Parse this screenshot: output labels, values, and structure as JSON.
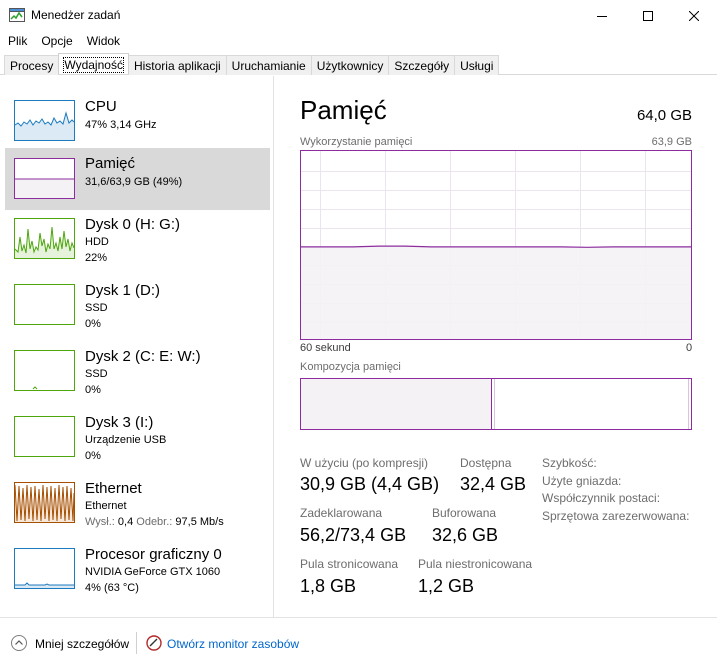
{
  "window": {
    "title": "Menedżer zadań"
  },
  "menu": [
    "Plik",
    "Opcje",
    "Widok"
  ],
  "tabs": [
    "Procesy",
    "Wydajność",
    "Historia aplikacji",
    "Uruchamianie",
    "Użytkownicy",
    "Szczegóły",
    "Usługi"
  ],
  "active_tab": "Wydajność",
  "sidebar": {
    "items": [
      {
        "title": "CPU",
        "line1": "47% 3,14 GHz",
        "line2": "",
        "color": "#1c7bbf",
        "selected": false
      },
      {
        "title": "Pamięć",
        "line1": "31,6/63,9 GB (49%)",
        "line2": "",
        "color": "#8c2c9e",
        "selected": true
      },
      {
        "title": "Dysk 0 (H: G:)",
        "line1": "HDD",
        "line2": "22%",
        "color": "#4da60c",
        "selected": false
      },
      {
        "title": "Dysk 1 (D:)",
        "line1": "SSD",
        "line2": "0%",
        "color": "#4da60c",
        "selected": false
      },
      {
        "title": "Dysk 2 (C: E: W:)",
        "line1": "SSD",
        "line2": "0%",
        "color": "#4da60c",
        "selected": false
      },
      {
        "title": "Dysk 3 (I:)",
        "line1": "Urządzenie USB",
        "line2": "0%",
        "color": "#4da60c",
        "selected": false
      },
      {
        "title": "Ethernet",
        "line1": "Ethernet",
        "line2_send_label": "Wysł.:",
        "line2_send_value": "0,4",
        "line2_recv_label": "Odebr.:",
        "line2_recv_value": "97,5 Mb/s",
        "color": "#a74f01",
        "selected": false
      },
      {
        "title": "Procesor graficzny 0",
        "line1": "NVIDIA GeForce GTX 1060",
        "line2": "4% (63 °C)",
        "color": "#1c7bbf",
        "selected": false
      }
    ]
  },
  "main": {
    "title": "Pamięć",
    "total": "64,0 GB",
    "usage_label": "Wykorzystanie pamięci",
    "usage_max": "63,9 GB",
    "axis_left": "60 sekund",
    "axis_right": "0",
    "usage_percent": 49,
    "composition_label": "Kompozycja pamięci",
    "stats": {
      "in_use_label": "W użyciu (po kompresji)",
      "in_use_value": "30,9 GB (4,4 GB)",
      "available_label": "Dostępna",
      "available_value": "32,4 GB",
      "committed_label": "Zadeklarowana",
      "committed_value": "56,2/73,4 GB",
      "cached_label": "Buforowana",
      "cached_value": "32,6 GB",
      "paged_label": "Pula stronicowana",
      "paged_value": "1,8 GB",
      "nonpaged_label": "Pula niestronicowana",
      "nonpaged_value": "1,2 GB"
    },
    "right_labels": [
      "Szybkość:",
      "Użyte gniazda:",
      "Współczynnik postaci:",
      "Sprzętowa zarezerwowana:"
    ]
  },
  "footer": {
    "less_details": "Mniej szczegółów",
    "open_monitor": "Otwórz monitor zasobów"
  },
  "colors": {
    "memory": "#8c2c9e",
    "memory_fill": "#f4f2f4",
    "cpu": "#1c7bbf",
    "disk": "#4da60c",
    "ethernet": "#a74f01",
    "link": "#0066cc"
  }
}
